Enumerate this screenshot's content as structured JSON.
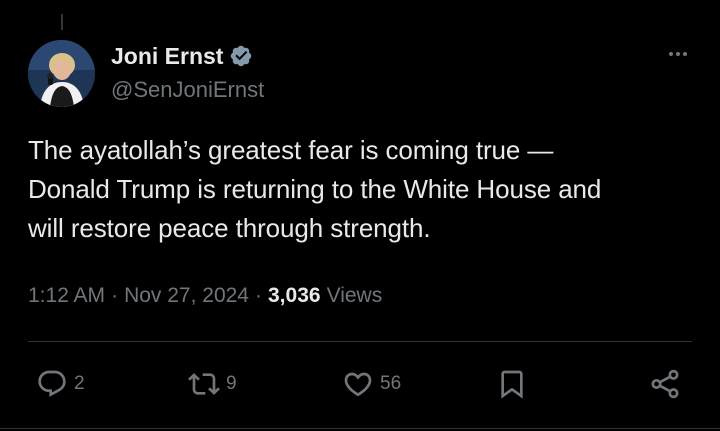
{
  "author": {
    "display_name": "Joni Ernst",
    "handle": "@SenJoniErnst",
    "verified": true
  },
  "tweet": {
    "lines": [
      "The ayatollah’s greatest fear is coming true —",
      "Donald Trump is returning to the White House and",
      "will restore peace through strength."
    ],
    "time": "1:12 AM",
    "separator": "·",
    "date": "Nov 27, 2024",
    "views_count": "3,036",
    "views_label": "Views"
  },
  "actions": {
    "replies": "2",
    "reposts": "9",
    "likes": "56"
  },
  "icons": {
    "more": "more-dots-icon",
    "verified": "verified-badge-icon",
    "reply": "reply-icon",
    "repost": "repost-icon",
    "like": "heart-icon",
    "bookmark": "bookmark-icon",
    "share": "share-icon"
  },
  "colors": {
    "background": "#000000",
    "text_primary": "#e7e9ea",
    "text_secondary": "#71767b",
    "divider": "#2f3336",
    "verified_badge": "#829aab"
  }
}
